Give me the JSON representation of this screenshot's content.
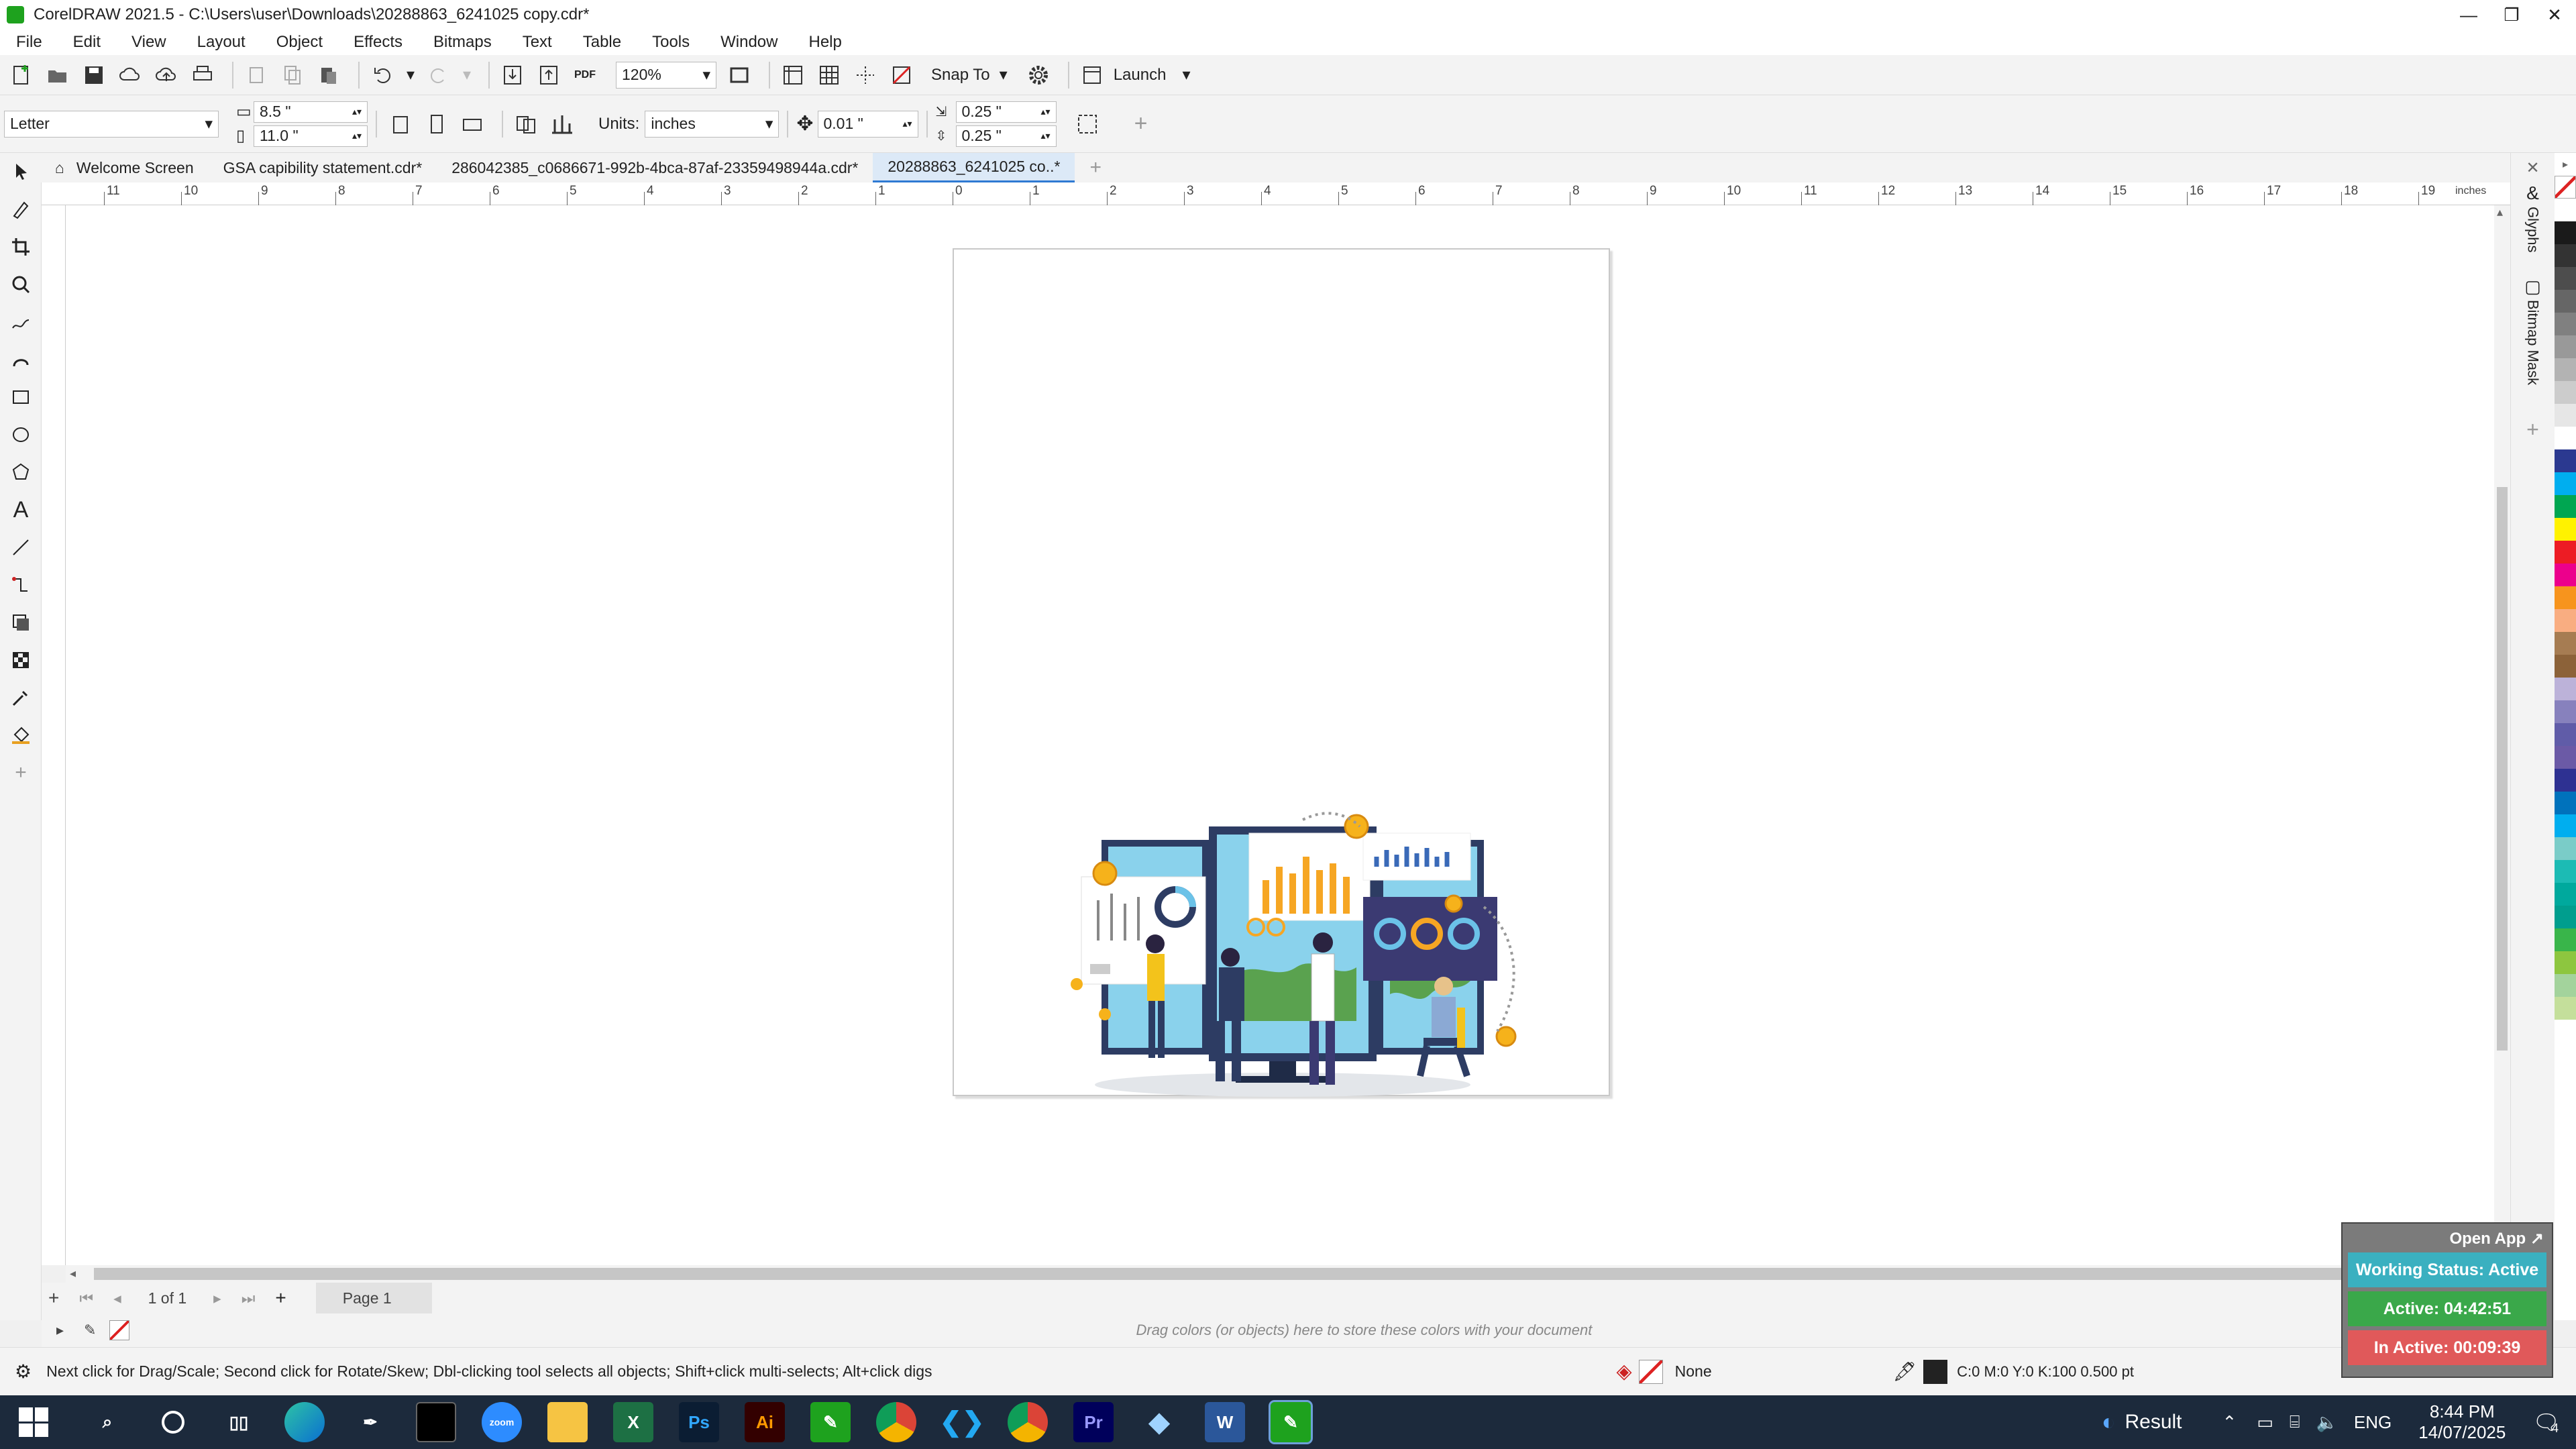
{
  "window": {
    "title": "CorelDRAW 2021.5 - C:\\Users\\user\\Downloads\\20288863_6241025 copy.cdr*",
    "minimize": "—",
    "restore": "❐",
    "close": "✕"
  },
  "menu": [
    "File",
    "Edit",
    "View",
    "Layout",
    "Object",
    "Effects",
    "Bitmaps",
    "Text",
    "Table",
    "Tools",
    "Window",
    "Help"
  ],
  "toolbar": {
    "zoom": "120%",
    "snap_to": "Snap To",
    "launch": "Launch",
    "pdf_label": "PDF"
  },
  "propertybar": {
    "page_size": "Letter",
    "width": "8.5 \"",
    "height": "11.0 \"",
    "units_label": "Units:",
    "units": "inches",
    "nudge": "0.01 \"",
    "dup_x": "0.25 \"",
    "dup_y": "0.25 \""
  },
  "tabs": [
    "Welcome Screen",
    "GSA  capibility statement.cdr*",
    "286042385_c0686671-992b-4bca-87af-23359498944a.cdr*",
    "20288863_6241025 co..*"
  ],
  "ruler": {
    "ticks": [
      "11",
      "10",
      "9",
      "8",
      "7",
      "6",
      "5",
      "4",
      "3",
      "2",
      "1",
      "0",
      "1",
      "2",
      "3",
      "4",
      "5",
      "6",
      "7",
      "8",
      "9",
      "10",
      "11",
      "12",
      "13",
      "14",
      "15",
      "16",
      "17",
      "18",
      "19"
    ],
    "unit": "inches"
  },
  "dockers": [
    "Glyphs",
    "Bitmap Mask"
  ],
  "palette": [
    "#ffffff",
    "#1a1a1a",
    "#333333",
    "#4d4d4d",
    "#666666",
    "#808080",
    "#999999",
    "#b3b3b3",
    "#cccccc",
    "#e6e6e6",
    "#ffffff",
    "#2b3990",
    "#00aeef",
    "#00a651",
    "#fff200",
    "#ed1c24",
    "#ec008c",
    "#f7941d",
    "#f9ad81",
    "#a67c52",
    "#8c6239",
    "#bcb2d9",
    "#8781bd",
    "#605ca8",
    "#6b5aa6",
    "#2e3192",
    "#0072bc",
    "#00aeef",
    "#7accc8",
    "#1cbbb4",
    "#00a99d",
    "#009e8e",
    "#39b54a",
    "#8dc63f",
    "#a3d39c",
    "#c4df9b"
  ],
  "page_nav": {
    "current": "1 of 1",
    "page_tab": "Page 1"
  },
  "color_well_hint": "Drag colors (or objects) here to store these colors with your document",
  "status": {
    "hint": "Next click for Drag/Scale; Second click for Rotate/Skew; Dbl-clicking tool selects all objects; Shift+click multi-selects; Alt+click digs",
    "fill": "None",
    "outline": "C:0 M:0 Y:0 K:100  0.500 pt"
  },
  "widget": {
    "open_app": "Open App ↗",
    "working": "Working Status: Active",
    "active": "Active: 04:42:51",
    "inactive": "In Active: 00:09:39"
  },
  "taskbar": {
    "result": "Result",
    "lang": "ENG",
    "time": "8:44 PM",
    "date": "14/07/2025",
    "notif": "4",
    "apps": [
      "Ps",
      "Ai",
      "Pr"
    ]
  }
}
